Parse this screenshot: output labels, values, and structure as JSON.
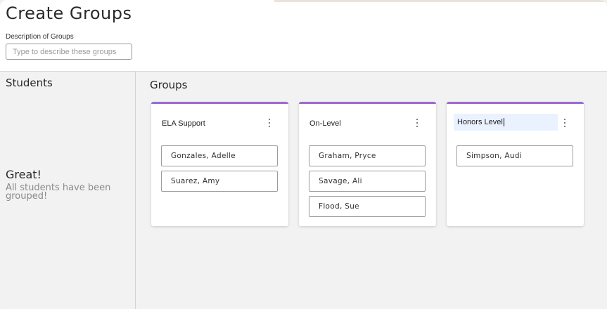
{
  "header": {
    "title": "Create Groups",
    "description_label": "Description of Groups",
    "description_placeholder": "Type to describe these groups",
    "description_value": ""
  },
  "students": {
    "heading": "Students",
    "empty_title": "Great!",
    "empty_message": "All students have been grouped!"
  },
  "groups": {
    "heading": "Groups",
    "accent_color": "#9d6bd1",
    "cards": [
      {
        "name": "ELA Support",
        "members": [
          "Gonzales, Adelle",
          "Suarez, Amy"
        ]
      },
      {
        "name": "On-Level",
        "members": [
          "Graham, Pryce",
          "Savage, Ali",
          "Flood, Sue"
        ]
      },
      {
        "name": "Honors Level",
        "members": [
          "Simpson, Audi"
        ],
        "editing": true
      }
    ],
    "menu_icon": "kebab-menu-icon"
  }
}
